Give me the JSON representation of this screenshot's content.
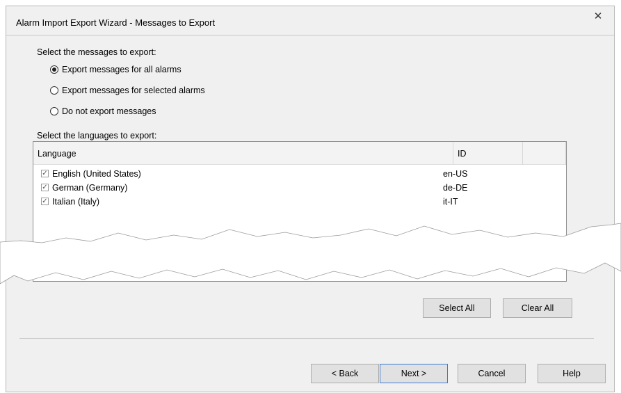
{
  "dialog": {
    "title": "Alarm Import Export Wizard - Messages to Export",
    "close_glyph": "✕"
  },
  "messages": {
    "prompt": "Select the messages to export:",
    "options": [
      {
        "label": "Export messages for all alarms",
        "selected": true
      },
      {
        "label": "Export messages for selected alarms",
        "selected": false
      },
      {
        "label": "Do not export messages",
        "selected": false
      }
    ]
  },
  "languages": {
    "prompt": "Select the languages to export:",
    "columns": [
      "Language",
      "ID",
      ""
    ],
    "rows": [
      {
        "name": "English (United States)",
        "id": "en-US",
        "checked": true
      },
      {
        "name": "German (Germany)",
        "id": "de-DE",
        "checked": true
      },
      {
        "name": "Italian (Italy)",
        "id": "it-IT",
        "checked": true
      }
    ],
    "select_all_label": "Select All",
    "clear_all_label": "Clear All"
  },
  "footer": {
    "back_label": "< Back",
    "next_label": "Next >",
    "cancel_label": "Cancel",
    "help_label": "Help"
  },
  "colors": {
    "dialog_bg": "#f0f0f0",
    "default_button_border": "#3b7ad6"
  },
  "icons": {
    "checkbox_glyph": "✓"
  }
}
